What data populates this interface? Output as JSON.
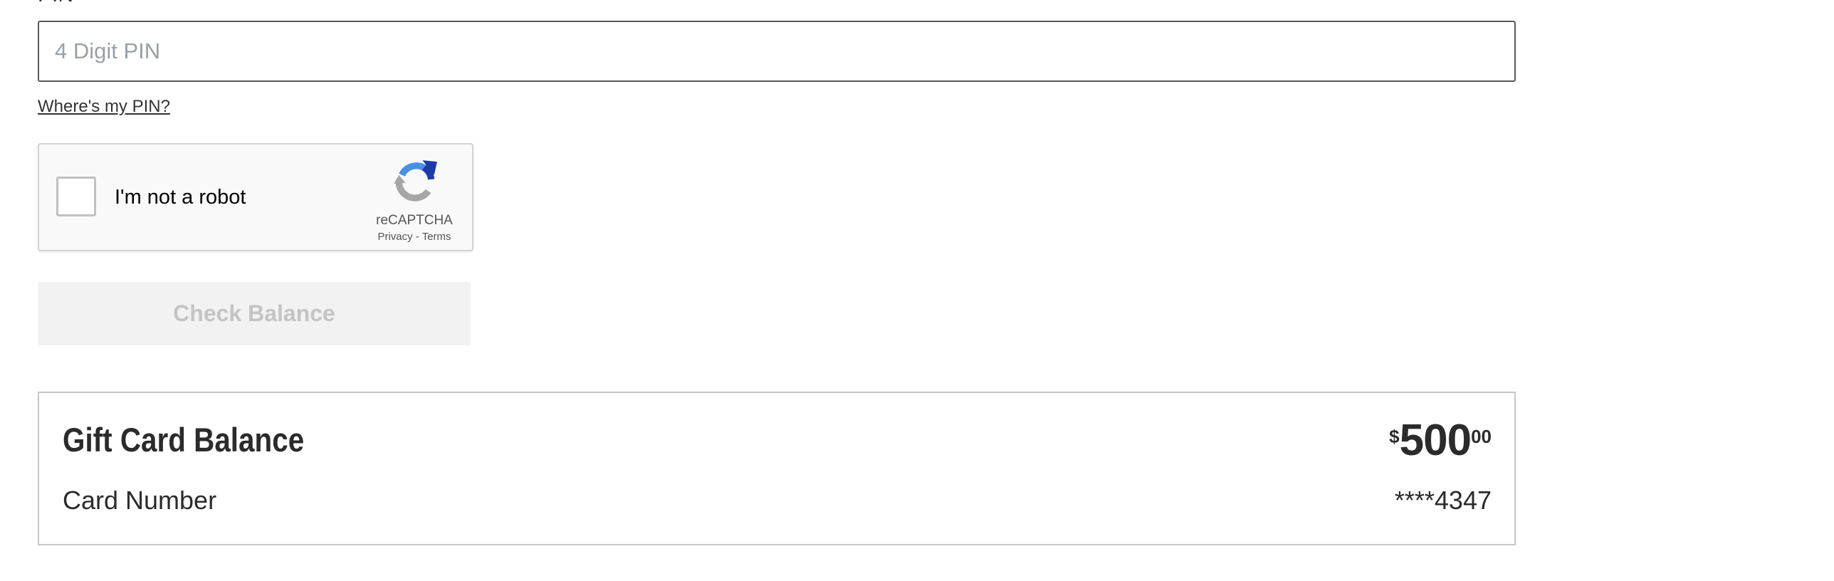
{
  "pin": {
    "label": "PIN",
    "placeholder": "4 Digit PIN",
    "value": "",
    "help_link": "Where's my PIN?"
  },
  "recaptcha": {
    "label": "I'm not a robot",
    "brand": "reCAPTCHA",
    "privacy": "Privacy",
    "separator": " - ",
    "terms": "Terms",
    "checked": false,
    "icon": "recaptcha-logo-icon"
  },
  "check_button": {
    "label": "Check Balance",
    "disabled": true
  },
  "balance": {
    "title": "Gift Card Balance",
    "currency_symbol": "$",
    "dollars": "500",
    "cents": "00",
    "card_number_label": "Card Number",
    "card_number_value": "****4347"
  },
  "colors": {
    "text": "#333333",
    "input_border": "#5a5a5a",
    "placeholder": "#9aa0a6",
    "button_disabled_bg": "#f2f2f2",
    "button_disabled_text": "#c4c4c4",
    "card_border": "#c7c7c7",
    "recaptcha_blue": "#4a90e2",
    "recaptcha_dark_blue": "#1c3aa9",
    "recaptcha_gray": "#a6a6a6"
  }
}
